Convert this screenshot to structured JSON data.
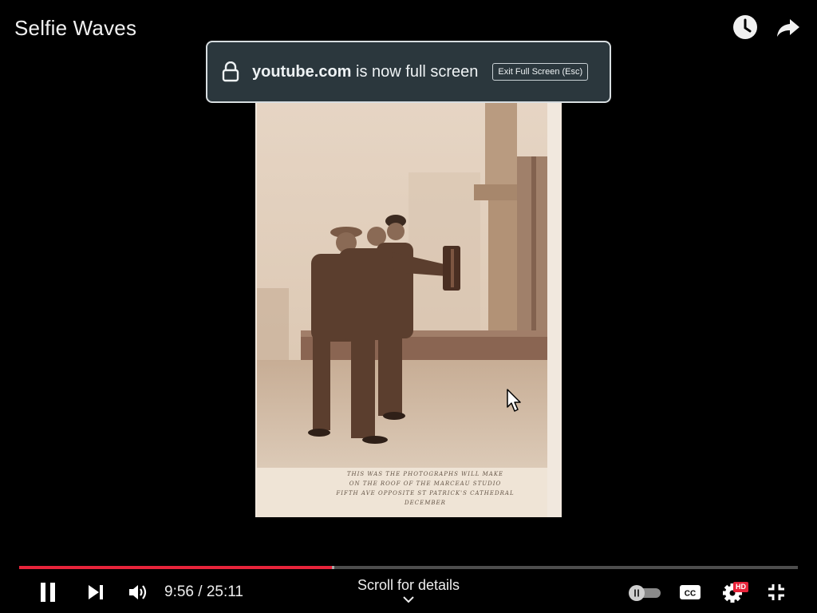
{
  "video": {
    "title": "Selfie Waves",
    "caption_lines": [
      "THIS WAS THE PHOTOGRAPHS WILL MAKE",
      "ON THE ROOF OF THE MARCEAU STUDIO",
      "FIFTH AVE OPPOSITE ST PATRICK'S CATHEDRAL",
      "DECEMBER"
    ]
  },
  "top_actions": {
    "watch_later_icon": "clock-icon",
    "share_icon": "share-arrow-icon"
  },
  "fullscreen_notice": {
    "domain": "youtube.com",
    "message": "is now full screen",
    "exit_label": "Exit Full Screen (Esc)"
  },
  "player": {
    "current_time": "9:56",
    "duration": "25:11",
    "time_display": "9:56 / 25:11",
    "played_fraction": 0.402,
    "buffered_fraction": 0.405,
    "scroll_hint": "Scroll for details",
    "quality_badge": "HD",
    "autoplay": "off"
  },
  "colors": {
    "progress_played": "#e8243a",
    "hd_badge": "#e8243a",
    "notice_bg": "#2b373d"
  }
}
